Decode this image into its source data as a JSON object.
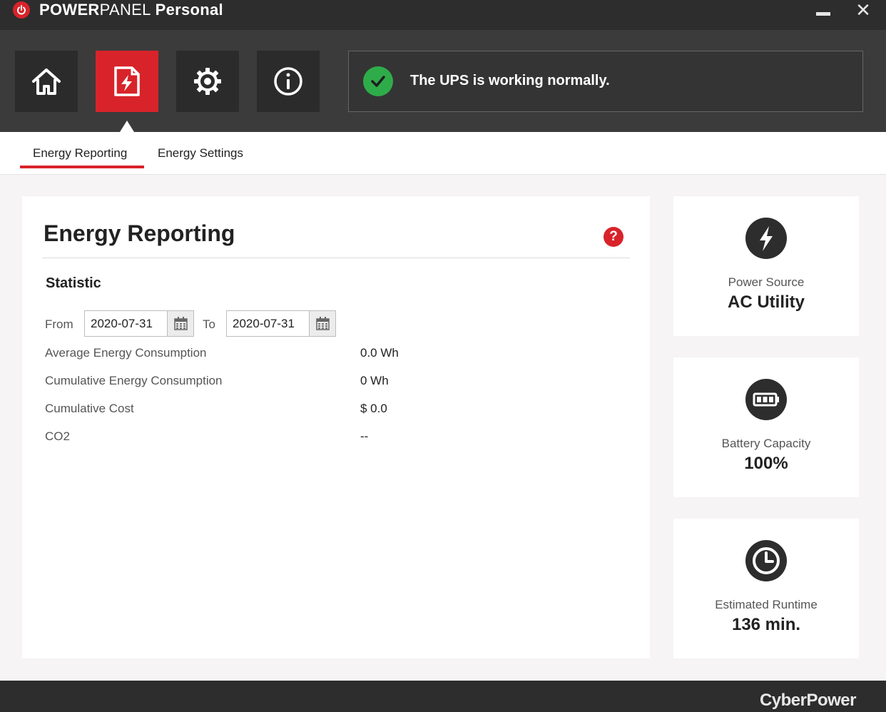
{
  "app": {
    "title_power": "POWER",
    "title_panel": "PANEL",
    "title_personal": "Personal",
    "close_glyph": "✕"
  },
  "nav": {
    "items": [
      {
        "name": "home",
        "icon": "home-icon",
        "active": false
      },
      {
        "name": "energy",
        "icon": "energy-document-icon",
        "active": true
      },
      {
        "name": "settings",
        "icon": "gear-icon",
        "active": false
      },
      {
        "name": "info",
        "icon": "info-icon",
        "active": false
      }
    ]
  },
  "status": {
    "icon": "checkmark-icon",
    "text": "The UPS is working normally.",
    "color": "#2fac4a"
  },
  "tabs": [
    {
      "label": "Energy Reporting",
      "active": true
    },
    {
      "label": "Energy Settings",
      "active": false
    }
  ],
  "panel": {
    "title": "Energy Reporting",
    "help_glyph": "?",
    "section_title": "Statistic",
    "from_label": "From",
    "to_label": "To",
    "from_date": "2020-07-31",
    "to_date": "2020-07-31",
    "stats": [
      {
        "label": "Average Energy Consumption",
        "value": "0.0 Wh"
      },
      {
        "label": "Cumulative Energy Consumption",
        "value": "0 Wh"
      },
      {
        "label": "Cumulative Cost",
        "value": "$ 0.0"
      },
      {
        "label": "CO2",
        "value": "--"
      }
    ]
  },
  "cards": [
    {
      "icon": "lightning-bolt-icon",
      "label": "Power Source",
      "value": "AC Utility"
    },
    {
      "icon": "battery-icon",
      "label": "Battery Capacity",
      "value": "100%"
    },
    {
      "icon": "clock-icon",
      "label": "Estimated Runtime",
      "value": "136 min."
    }
  ],
  "footer": {
    "brand": "CyberPower"
  },
  "colors": {
    "accent": "#d8232a",
    "titlebar": "#2d2d2d",
    "header": "#3b3b3b",
    "success": "#2fac4a"
  }
}
